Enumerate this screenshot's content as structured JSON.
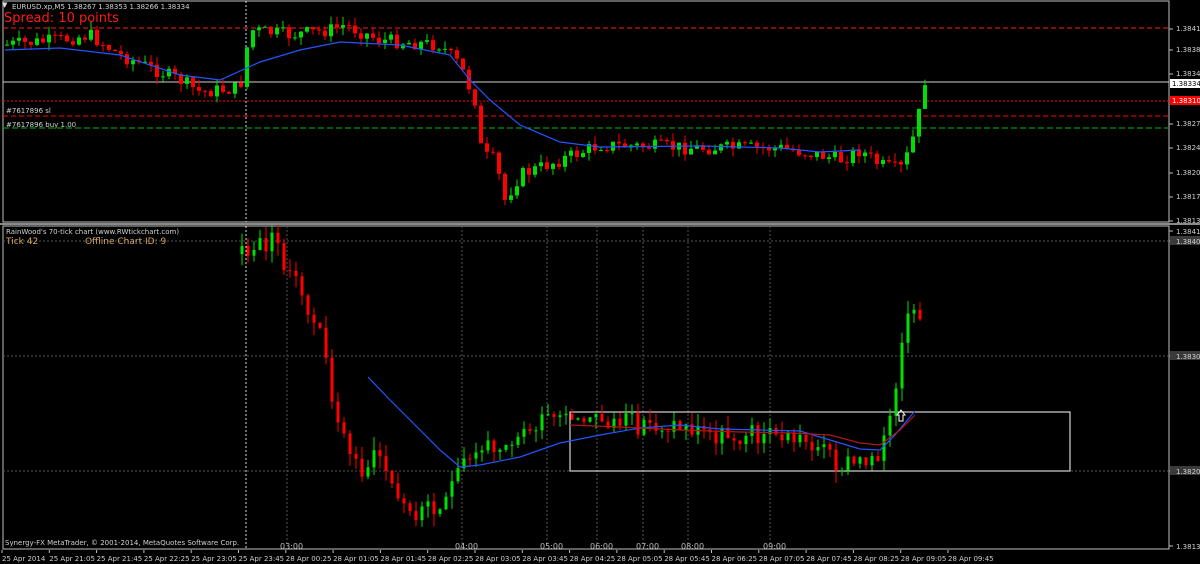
{
  "top_chart": {
    "menu_icon": "triangle-down-icon",
    "header": "EURUSD.xp,M5  1.38267 1.38353 1.38266 1.38334",
    "spread": "Spread: 10 points",
    "order_labels": [
      "#7617896 sl",
      "#7617896 buy 1.00"
    ],
    "price_ticks": [
      "1.38415",
      "1.38380",
      "1.38345",
      "1.38334",
      "1.38275",
      "1.38240",
      "1.38205",
      "1.38170",
      "1.38135"
    ],
    "price_tags": [
      {
        "text": "1.38334",
        "color": "#ffffff",
        "bg": "#ffffff",
        "fg": "#000000"
      },
      {
        "text": "1.38310",
        "color": "#ff0000",
        "bg": "#ff0000",
        "fg": "#ff0000"
      }
    ]
  },
  "bottom_chart": {
    "header": "RainWood's 70-tick chart  (www.RWtickchart.com)",
    "tick_label": "Tick 42",
    "offline_label": "Offline Chart ID: 9",
    "price_ticks": [
      "1.3841",
      "1.38400",
      "1.38300",
      "1.38200",
      "1.3813"
    ],
    "time_marks": [
      "03:00",
      "04:00",
      "05:00",
      "06:00",
      "07:00",
      "08:00",
      "09:00"
    ],
    "copyright": "Synergy-FX MetaTrader, © 2001-2014, MetaQuotes Software Corp."
  },
  "time_axis": [
    "25 Apr 2014",
    "25 Apr 21:05",
    "25 Apr 21:45",
    "25 Apr 22:25",
    "25 Apr 23:05",
    "25 Apr 23:45",
    "28 Apr 00:25",
    "28 Apr 01:05",
    "28 Apr 01:45",
    "28 Apr 02:25",
    "28 Apr 03:05",
    "28 Apr 03:45",
    "28 Apr 04:25",
    "28 Apr 05:05",
    "28 Apr 05:45",
    "28 Apr 06:25",
    "28 Apr 07:05",
    "28 Apr 07:45",
    "28 Apr 08:25",
    "28 Apr 09:05",
    "28 Apr 09:45"
  ],
  "colors": {
    "bull": "#00e000",
    "bear": "#ff0000",
    "ma_blue": "#2255ff",
    "ma_red": "#b01818",
    "grid": "#555555",
    "frame": "#c0c0c0",
    "ask_line": "#ff1a1a",
    "tp_line": "#00c000",
    "cursor": "#e0e0e0"
  }
}
